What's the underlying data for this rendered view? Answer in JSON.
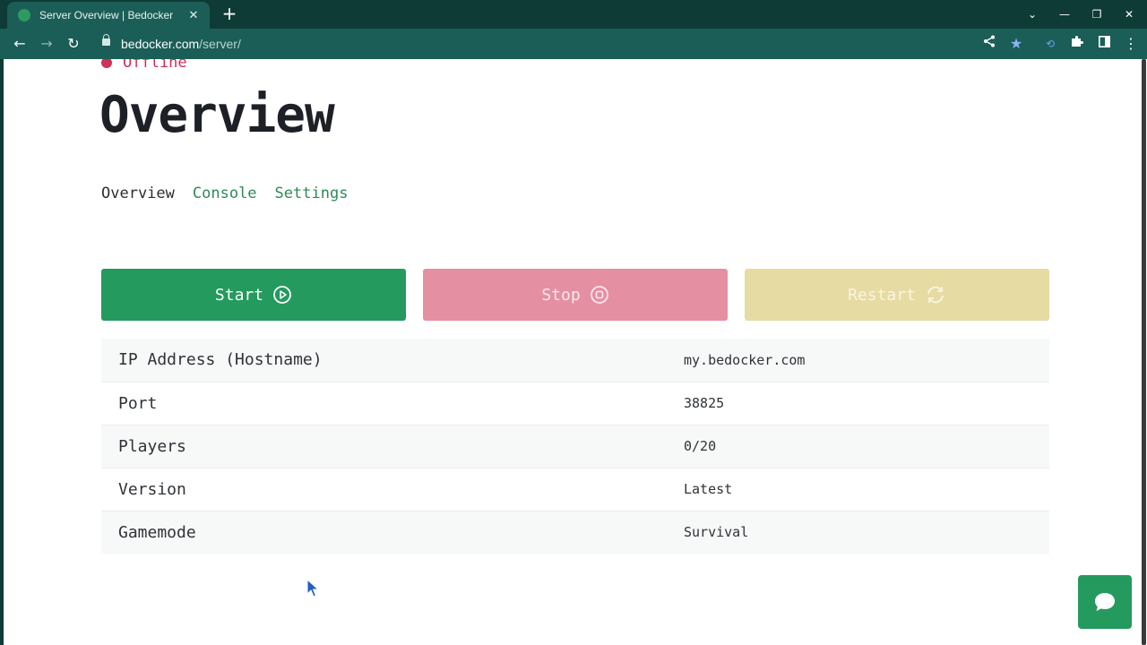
{
  "browser": {
    "tab_title": "Server Overview | Bedocker",
    "tab_close_icon": "close-icon",
    "new_tab": "+",
    "url_host": "bedocker.com",
    "url_path": "/server/"
  },
  "status": {
    "text": "Offline",
    "color": "#cf2f58"
  },
  "page": {
    "title": "Overview",
    "tabs": [
      {
        "label": "Overview",
        "active": true
      },
      {
        "label": "Console",
        "active": false
      },
      {
        "label": "Settings",
        "active": false
      }
    ]
  },
  "actions": {
    "start": {
      "label": "Start",
      "icon": "play-circle-icon",
      "color": "#249a5e"
    },
    "stop": {
      "label": "Stop",
      "icon": "stop-circle-icon",
      "color": "#e48fa2"
    },
    "restart": {
      "label": "Restart",
      "icon": "refresh-icon",
      "color": "#e6dba3"
    }
  },
  "info": [
    {
      "key": "IP Address (Hostname)",
      "value": "my.bedocker.com"
    },
    {
      "key": "Port",
      "value": "38825"
    },
    {
      "key": "Players",
      "value": "0/20"
    },
    {
      "key": "Version",
      "value": "Latest"
    },
    {
      "key": "Gamemode",
      "value": "Survival"
    }
  ],
  "chat": {
    "icon": "chat-bubble-icon",
    "color": "#249a5e"
  }
}
